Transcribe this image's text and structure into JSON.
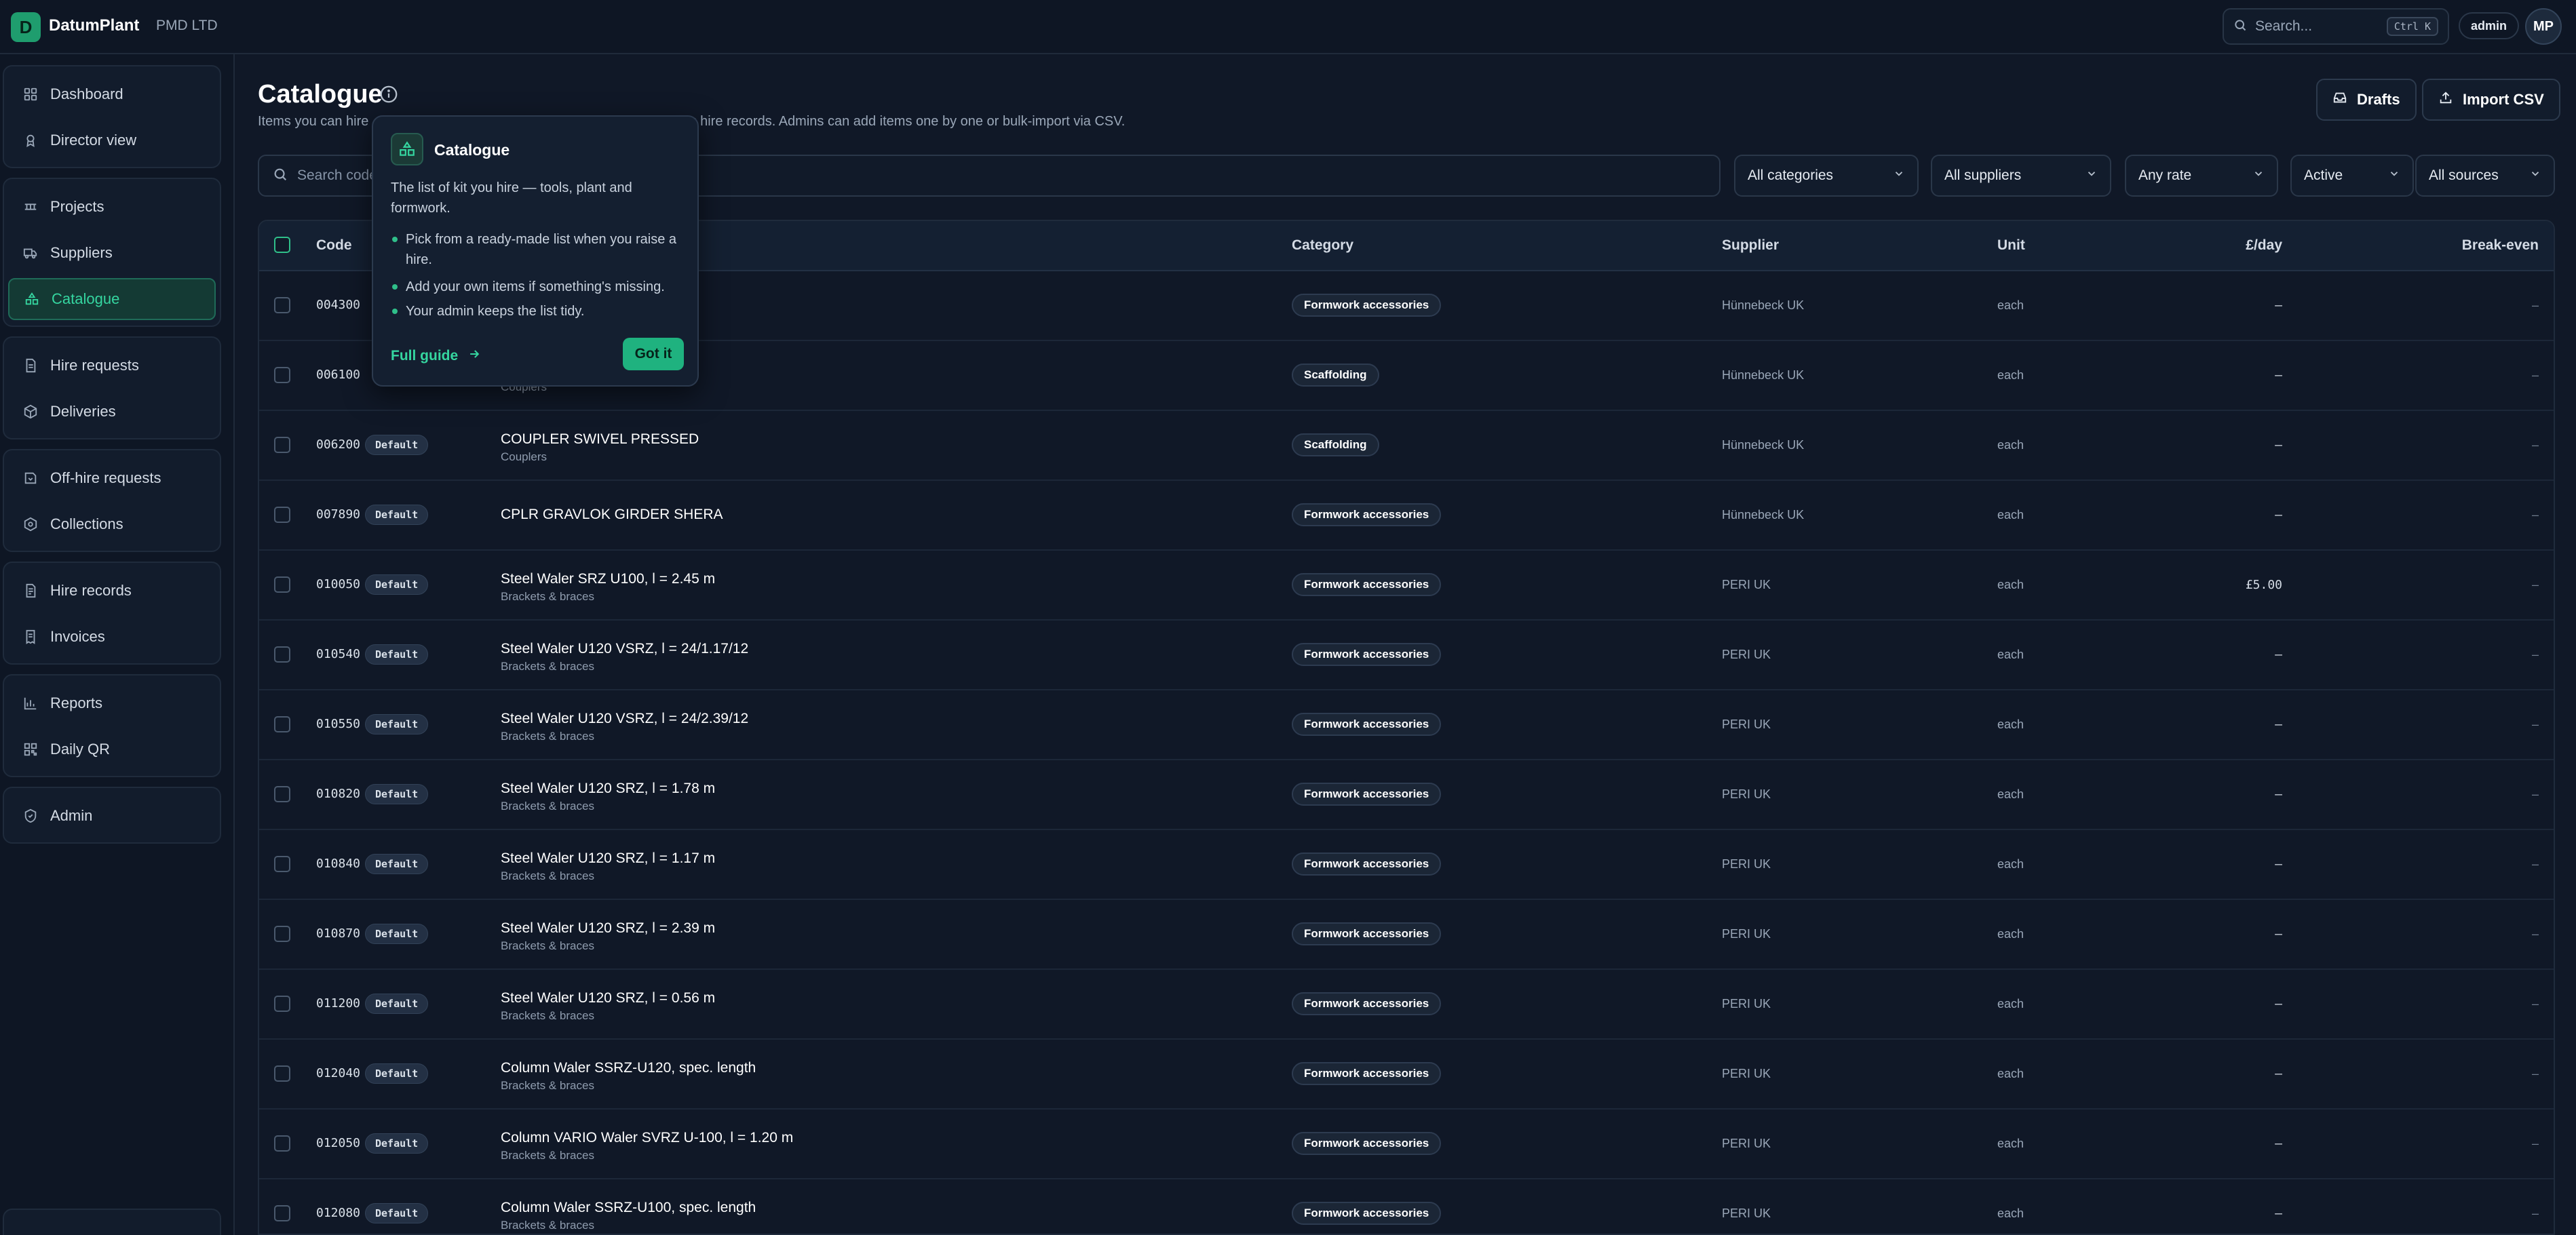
{
  "app": {
    "brand": "DatumPlant",
    "logo_letter": "D",
    "org": "PMD LTD"
  },
  "topbar": {
    "search_placeholder": "Search...",
    "shortcut": "Ctrl K",
    "user_role": "admin",
    "avatar_initials": "MP"
  },
  "sidebar": {
    "groups": [
      [
        {
          "label": "Dashboard",
          "icon": "dashboard-icon"
        },
        {
          "label": "Director view",
          "icon": "award-icon"
        }
      ],
      [
        {
          "label": "Projects",
          "icon": "projects-icon"
        },
        {
          "label": "Suppliers",
          "icon": "truck-icon"
        },
        {
          "label": "Catalogue",
          "icon": "catalogue-icon",
          "active": true
        }
      ],
      [
        {
          "label": "Hire requests",
          "icon": "document-icon"
        },
        {
          "label": "Deliveries",
          "icon": "package-icon"
        }
      ],
      [
        {
          "label": "Off-hire requests",
          "icon": "offhire-icon"
        },
        {
          "label": "Collections",
          "icon": "collections-icon"
        }
      ],
      [
        {
          "label": "Hire records",
          "icon": "records-icon"
        },
        {
          "label": "Invoices",
          "icon": "invoice-icon"
        }
      ],
      [
        {
          "label": "Reports",
          "icon": "chart-icon"
        },
        {
          "label": "Daily QR",
          "icon": "qr-icon"
        }
      ],
      [
        {
          "label": "Admin",
          "icon": "shield-icon"
        }
      ]
    ]
  },
  "page": {
    "title": "Catalogue",
    "subtitle_start": "Items you can hire",
    "subtitle_end": "g hire records. Admins can add items one by one or bulk-import via CSV.",
    "drafts_label": "Drafts",
    "import_label": "Import CSV"
  },
  "filters": {
    "search_placeholder": "Search code",
    "category": "All categories",
    "supplier": "All suppliers",
    "rate": "Any rate",
    "status": "Active",
    "source": "All sources"
  },
  "table": {
    "columns": {
      "code": "Code",
      "category": "Category",
      "supplier": "Supplier",
      "unit": "Unit",
      "rate": "£/day",
      "breakeven": "Break-even"
    },
    "rows": [
      {
        "code": "004300",
        "badge": "",
        "name": "",
        "sub": "",
        "category": "Formwork accessories",
        "supplier": "Hünnebeck UK",
        "unit": "each",
        "rate": "–",
        "breakeven": "–"
      },
      {
        "code": "006100",
        "badge": "",
        "name": "",
        "sub": "Couplers",
        "category": "Scaffolding",
        "supplier": "Hünnebeck UK",
        "unit": "each",
        "rate": "–",
        "breakeven": "–"
      },
      {
        "code": "006200",
        "badge": "Default",
        "name": "COUPLER SWIVEL PRESSED",
        "sub": "Couplers",
        "category": "Scaffolding",
        "supplier": "Hünnebeck UK",
        "unit": "each",
        "rate": "–",
        "breakeven": "–"
      },
      {
        "code": "007890",
        "badge": "Default",
        "name": "CPLR GRAVLOK GIRDER SHERA",
        "sub": "",
        "category": "Formwork accessories",
        "supplier": "Hünnebeck UK",
        "unit": "each",
        "rate": "–",
        "breakeven": "–"
      },
      {
        "code": "010050",
        "badge": "Default",
        "name": "Steel Waler SRZ U100, l = 2.45 m",
        "sub": "Brackets & braces",
        "category": "Formwork accessories",
        "supplier": "PERI UK",
        "unit": "each",
        "rate": "£5.00",
        "breakeven": "–"
      },
      {
        "code": "010540",
        "badge": "Default",
        "name": "Steel Waler U120 VSRZ, l = 24/1.17/12",
        "sub": "Brackets & braces",
        "category": "Formwork accessories",
        "supplier": "PERI UK",
        "unit": "each",
        "rate": "–",
        "breakeven": "–"
      },
      {
        "code": "010550",
        "badge": "Default",
        "name": "Steel Waler U120 VSRZ, l = 24/2.39/12",
        "sub": "Brackets & braces",
        "category": "Formwork accessories",
        "supplier": "PERI UK",
        "unit": "each",
        "rate": "–",
        "breakeven": "–"
      },
      {
        "code": "010820",
        "badge": "Default",
        "name": "Steel Waler U120 SRZ, l = 1.78 m",
        "sub": "Brackets & braces",
        "category": "Formwork accessories",
        "supplier": "PERI UK",
        "unit": "each",
        "rate": "–",
        "breakeven": "–"
      },
      {
        "code": "010840",
        "badge": "Default",
        "name": "Steel Waler U120 SRZ, l = 1.17 m",
        "sub": "Brackets & braces",
        "category": "Formwork accessories",
        "supplier": "PERI UK",
        "unit": "each",
        "rate": "–",
        "breakeven": "–"
      },
      {
        "code": "010870",
        "badge": "Default",
        "name": "Steel Waler U120 SRZ, l = 2.39 m",
        "sub": "Brackets & braces",
        "category": "Formwork accessories",
        "supplier": "PERI UK",
        "unit": "each",
        "rate": "–",
        "breakeven": "–"
      },
      {
        "code": "011200",
        "badge": "Default",
        "name": "Steel Waler U120 SRZ, l = 0.56 m",
        "sub": "Brackets & braces",
        "category": "Formwork accessories",
        "supplier": "PERI UK",
        "unit": "each",
        "rate": "–",
        "breakeven": "–"
      },
      {
        "code": "012040",
        "badge": "Default",
        "name": "Column Waler SSRZ-U120, spec. length",
        "sub": "Brackets & braces",
        "category": "Formwork accessories",
        "supplier": "PERI UK",
        "unit": "each",
        "rate": "–",
        "breakeven": "–"
      },
      {
        "code": "012050",
        "badge": "Default",
        "name": "Column VARIO Waler SVRZ U-100, l = 1.20 m",
        "sub": "Brackets & braces",
        "category": "Formwork accessories",
        "supplier": "PERI UK",
        "unit": "each",
        "rate": "–",
        "breakeven": "–"
      },
      {
        "code": "012080",
        "badge": "Default",
        "name": "Column Waler SSRZ-U100, spec. length",
        "sub": "Brackets & braces",
        "category": "Formwork accessories",
        "supplier": "PERI UK",
        "unit": "each",
        "rate": "–",
        "breakeven": "–"
      }
    ]
  },
  "popover": {
    "title": "Catalogue",
    "text": "The list of kit you hire — tools, plant and formwork.",
    "bullets": [
      "Pick from a ready-made list when you raise a hire.",
      "Add your own items if something's missing.",
      "Your admin keeps the list tidy."
    ],
    "link": "Full guide",
    "button": "Got it"
  },
  "colors": {
    "accent": "#1fb27f",
    "background": "#101827",
    "sidebar": "#0e1624"
  }
}
